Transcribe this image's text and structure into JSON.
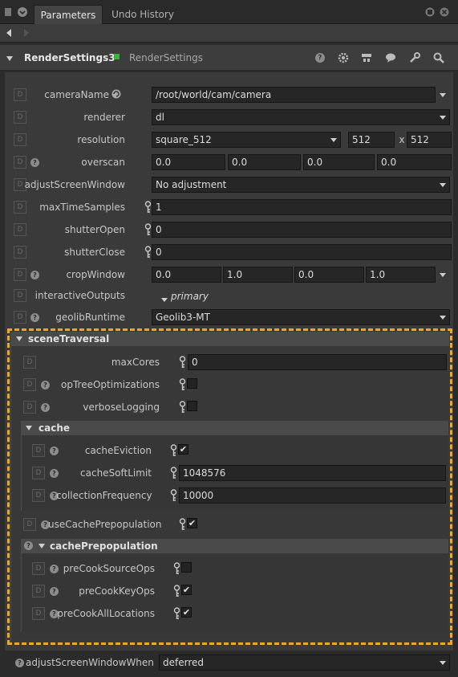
{
  "tabs": [
    {
      "label": "Parameters"
    },
    {
      "label": "Undo History"
    }
  ],
  "node": {
    "name": "RenderSettings3",
    "type": "RenderSettings"
  },
  "params": {
    "cameraName": {
      "label": "cameraName",
      "value": "/root/world/cam/camera"
    },
    "renderer": {
      "label": "renderer",
      "value": "dl"
    },
    "resolution": {
      "label": "resolution",
      "value": "square_512",
      "w": "512",
      "x": "x",
      "h": "512"
    },
    "overscan": {
      "label": "overscan",
      "values": [
        "0.0",
        "0.0",
        "0.0",
        "0.0"
      ]
    },
    "adjustScreenWindow": {
      "label": "adjustScreenWindow",
      "value": "No adjustment"
    },
    "maxTimeSamples": {
      "label": "maxTimeSamples",
      "value": "1"
    },
    "shutterOpen": {
      "label": "shutterOpen",
      "value": "0"
    },
    "shutterClose": {
      "label": "shutterClose",
      "value": "0"
    },
    "cropWindow": {
      "label": "cropWindow",
      "values": [
        "0.0",
        "1.0",
        "0.0",
        "1.0"
      ]
    },
    "interactiveOutputs": {
      "label": "interactiveOutputs",
      "value": "primary"
    },
    "geolibRuntime": {
      "label": "geolibRuntime",
      "value": "Geolib3-MT"
    },
    "adjustScreenWindowWhen": {
      "label": "adjustScreenWindowWhen",
      "value": "deferred"
    }
  },
  "sceneTraversal": {
    "title": "sceneTraversal",
    "maxCores": {
      "label": "maxCores",
      "value": "0"
    },
    "opTreeOptimizations": {
      "label": "opTreeOptimizations",
      "checked": false
    },
    "verboseLogging": {
      "label": "verboseLogging",
      "checked": false
    },
    "cache": {
      "title": "cache",
      "cacheEviction": {
        "label": "cacheEviction",
        "checked": true
      },
      "cacheSoftLimit": {
        "label": "cacheSoftLimit",
        "value": "1048576"
      },
      "collectionFrequency": {
        "label": "collectionFrequency",
        "value": "10000"
      }
    },
    "useCachePrepopulation": {
      "label": "useCachePrepopulation",
      "checked": true
    },
    "cachePrepopulation": {
      "title": "cachePrepopulation",
      "preCookSourceOps": {
        "label": "preCookSourceOps",
        "checked": false
      },
      "preCookKeyOps": {
        "label": "preCookKeyOps",
        "checked": true
      },
      "preCookAllLocations": {
        "label": "preCookAllLocations",
        "checked": true
      }
    }
  },
  "glyphs": {
    "check": "✔",
    "d": "D",
    "q": "?"
  },
  "colors": {
    "highlight": "#f2a720",
    "nodeStatus": "#3ab33a"
  }
}
